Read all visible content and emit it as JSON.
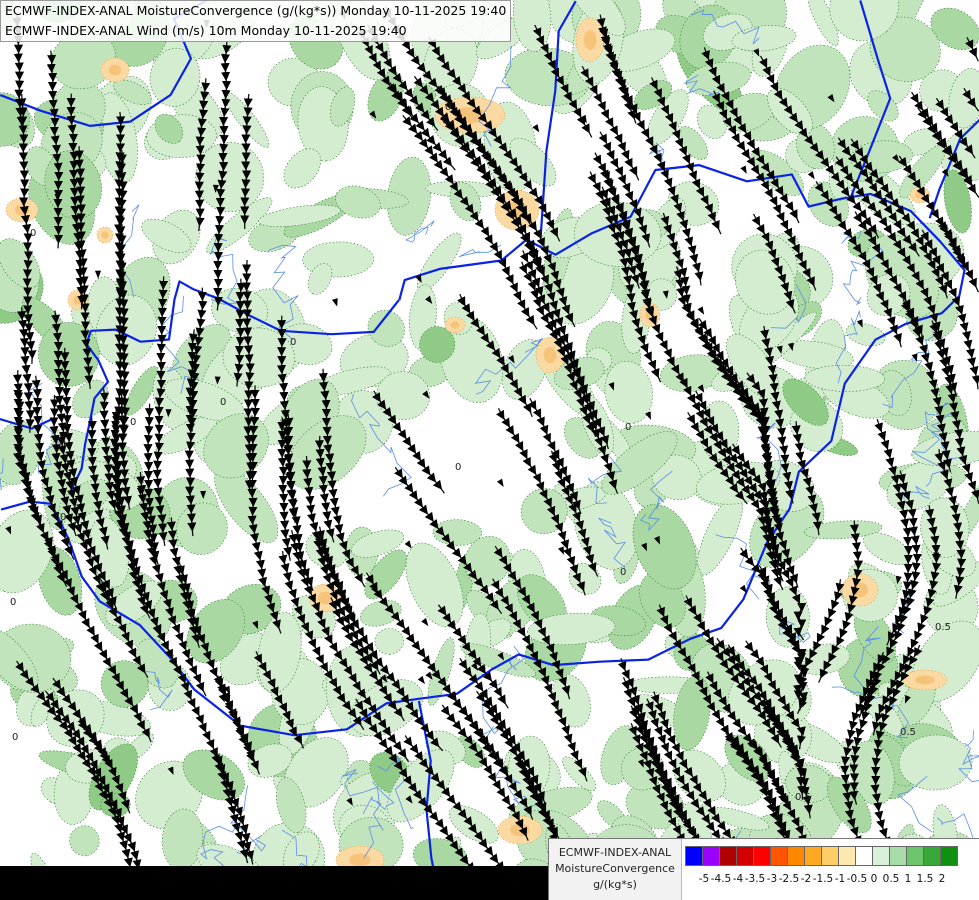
{
  "header": {
    "line1": "ECMWF-INDEX-ANAL MoistureConvergence (g/(kg*s)) Monday 10-11-2025 19:40",
    "line2": "ECMWF-INDEX-ANAL Wind (m/s) 10m Monday 10-11-2025 19:40"
  },
  "legend": {
    "line1": "ECMWF-INDEX-ANAL",
    "line2": "MoistureConvergence",
    "units": "g/(kg*s)",
    "colors": [
      "#0000ff",
      "#9900ff",
      "#b00000",
      "#d40000",
      "#ff0000",
      "#ff5500",
      "#ff8800",
      "#ffaa22",
      "#ffcc66",
      "#ffe8b0",
      "#ffffff",
      "#d8f0d8",
      "#a8dca8",
      "#6cc46c",
      "#38a838",
      "#109010"
    ],
    "ticks": [
      "-5",
      "-4.5",
      "-4",
      "-3.5",
      "-3",
      "-2.5",
      "-2",
      "-1.5",
      "-1",
      "-0.5",
      "0",
      "0.5",
      "1",
      "1.5",
      "2"
    ]
  },
  "map": {
    "contour_labels": [
      "0",
      "0",
      "0",
      "0",
      "0",
      "0",
      "0",
      "0",
      "0",
      "0.5",
      "0.5",
      "0.5",
      "0",
      "0"
    ]
  }
}
